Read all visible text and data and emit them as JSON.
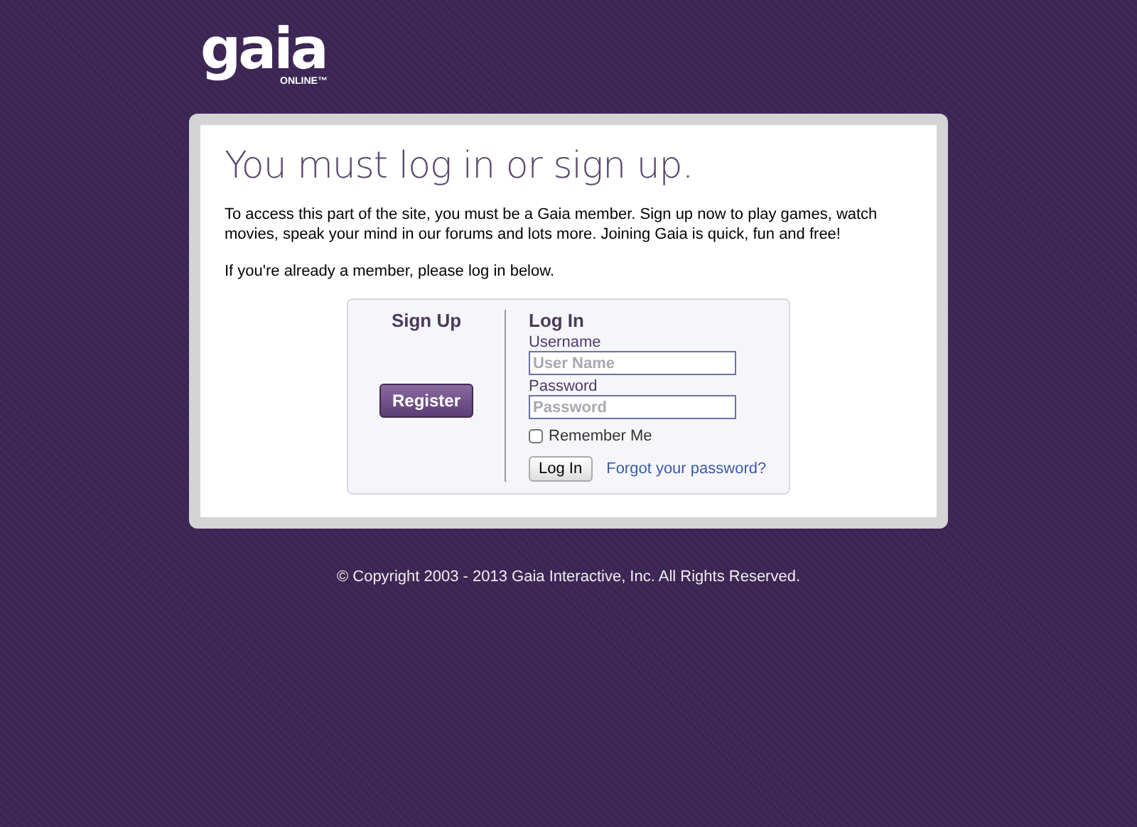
{
  "logo": {
    "name": "gaia",
    "tagline": "ONLINE™"
  },
  "title": "You must log in or sign up.",
  "intro": "To access this part of the site, you must be a Gaia member. Sign up now to play games, watch movies, speak your mind in our forums and lots more. Joining Gaia is quick, fun and free!",
  "member_note": "If you're already a member, please log in below.",
  "signup": {
    "heading": "Sign Up",
    "button": "Register"
  },
  "login": {
    "heading": "Log In",
    "username_label": "Username",
    "username_placeholder": "User Name",
    "password_label": "Password",
    "password_placeholder": "Password",
    "remember": {
      "label": "Remember Me",
      "checked": false
    },
    "button": "Log In",
    "forgot_link": "Forgot your password?"
  },
  "footer": "© Copyright 2003 - 2013 Gaia Interactive, Inc. All Rights Reserved."
}
